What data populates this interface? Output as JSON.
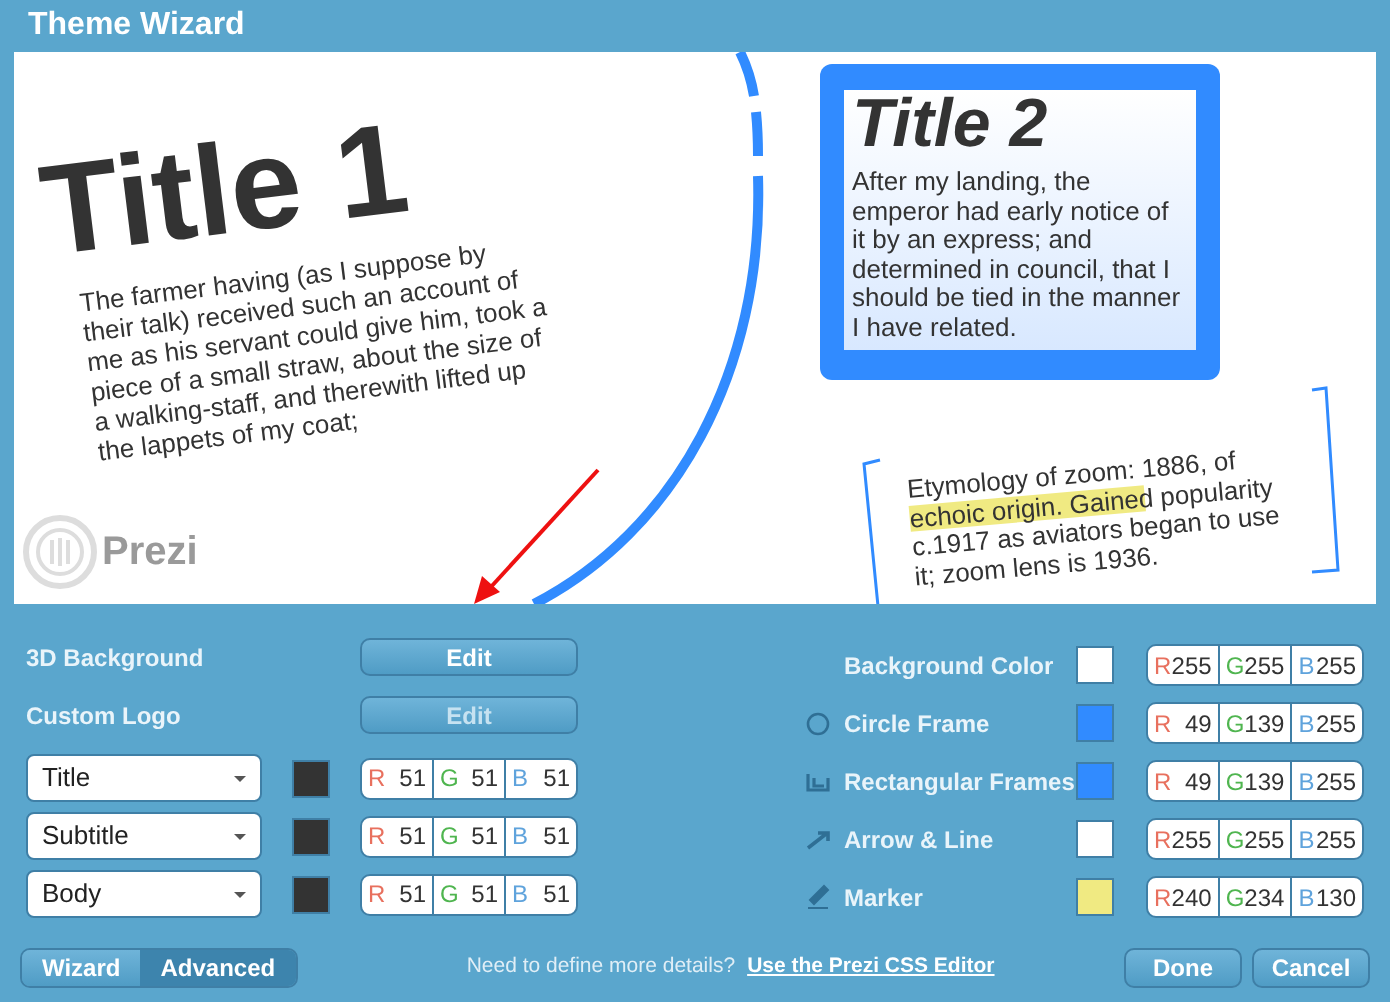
{
  "window": {
    "title": "Theme Wizard"
  },
  "canvas": {
    "title_1": "Title 1",
    "body_1": "The farmer having (as I suppose by their talk) received such an account of me as his servant could give him, took a piece of a small straw, about the size of a walking-staff, and therewith lifted up the lappets of my coat;",
    "title_2": "Title 2",
    "body_2": "After my landing, the emperor had early notice of it by an express; and determined in council, that I should be tied in the manner I have related.",
    "note": "Etymology of zoom: 1886, of echoic origin. Gained popularity c.1917 as aviators began to use it; zoom lens is 1936.",
    "logo": "Prezi"
  },
  "left_settings": [
    {
      "label": "3D Background",
      "button": "Edit",
      "disabled": false
    },
    {
      "label": "Custom Logo",
      "button": "Edit",
      "disabled": true
    }
  ],
  "font_rows": [
    {
      "font": "Title",
      "color": "#333333",
      "rgb": [
        {
          "label": "R",
          "value": "51"
        },
        {
          "label": "G",
          "value": "51"
        },
        {
          "label": "B",
          "value": "51"
        }
      ]
    },
    {
      "font": "Subtitle",
      "color": "#333333",
      "rgb": [
        {
          "label": "R",
          "value": "51"
        },
        {
          "label": "G",
          "value": "51"
        },
        {
          "label": "B",
          "value": "51"
        }
      ]
    },
    {
      "font": "Body",
      "color": "#333333",
      "rgb": [
        {
          "label": "R",
          "value": "51"
        },
        {
          "label": "G",
          "value": "51"
        },
        {
          "label": "B",
          "value": "51"
        }
      ]
    }
  ],
  "color_rows": [
    {
      "kind": "plain",
      "label": "Background Color",
      "color": "#ffffff",
      "rgb": [
        {
          "label": "R",
          "value": "255"
        },
        {
          "label": "G",
          "value": "255"
        },
        {
          "label": "B",
          "value": "255"
        }
      ]
    },
    {
      "kind": "circle",
      "label": "Circle Frame",
      "color": "#318bff",
      "rgb": [
        {
          "label": "R",
          "value": "49"
        },
        {
          "label": "G",
          "value": "139"
        },
        {
          "label": "B",
          "value": "255"
        }
      ]
    },
    {
      "kind": "rect",
      "label": "Rectangular Frames",
      "color": "#318bff",
      "rgb": [
        {
          "label": "R",
          "value": "49"
        },
        {
          "label": "G",
          "value": "139"
        },
        {
          "label": "B",
          "value": "255"
        }
      ]
    },
    {
      "kind": "arrow",
      "label": "Arrow & Line",
      "color": "#ffffff",
      "rgb": [
        {
          "label": "R",
          "value": "255"
        },
        {
          "label": "G",
          "value": "255"
        },
        {
          "label": "B",
          "value": "255"
        }
      ]
    },
    {
      "kind": "marker",
      "label": "Marker",
      "color": "#f0ea82",
      "rgb": [
        {
          "label": "R",
          "value": "240"
        },
        {
          "label": "G",
          "value": "234"
        },
        {
          "label": "B",
          "value": "130"
        }
      ]
    }
  ],
  "mode_toggle": [
    {
      "label": "Wizard",
      "selected": false
    },
    {
      "label": "Advanced",
      "selected": true
    }
  ],
  "footer": {
    "prompt": "Need to define more details?",
    "link": "Use the Prezi CSS Editor"
  },
  "buttons": [
    "Done",
    "Cancel"
  ]
}
